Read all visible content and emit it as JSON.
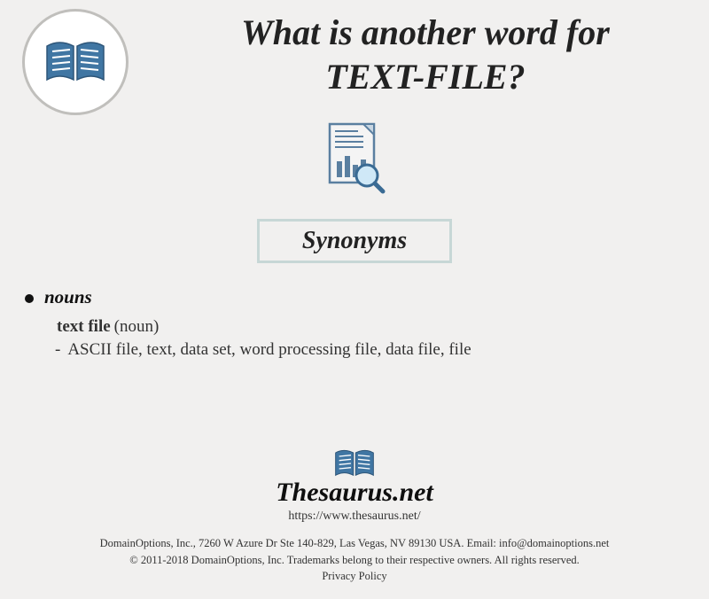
{
  "title_line1": "What is another word for",
  "title_line2": "TEXT-FILE?",
  "section_heading": "Synonyms",
  "entry": {
    "pos_heading": "nouns",
    "headword": "text file",
    "pos_paren": "(noun)",
    "synonyms": "ASCII file, text, data set, word processing file, data file, file"
  },
  "footer_logo": {
    "site_name": "Thesaurus.net",
    "site_url": "https://www.thesaurus.net/"
  },
  "footer": {
    "line1": "DomainOptions, Inc., 7260 W Azure Dr Ste 140-829, Las Vegas, NV 89130 USA. Email: info@domainoptions.net",
    "line2": "© 2011-2018 DomainOptions, Inc. Trademarks belong to their respective owners. All rights reserved.",
    "line3": "Privacy Policy"
  }
}
